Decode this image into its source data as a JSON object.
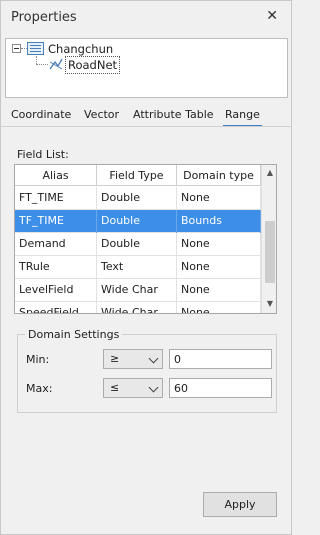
{
  "panel": {
    "title": "Properties",
    "close_glyph": "✕"
  },
  "tree": {
    "root": {
      "label": "Changchun",
      "icon": "datasource-icon",
      "expanded": true
    },
    "child": {
      "label": "RoadNet",
      "icon": "line-dataset-icon"
    }
  },
  "tabs": [
    {
      "label": "Coordinate",
      "active": false
    },
    {
      "label": "Vector",
      "active": false
    },
    {
      "label": "Attribute Table",
      "active": false
    },
    {
      "label": "Range",
      "active": true
    }
  ],
  "field_list": {
    "label": "Field List:",
    "columns": [
      "Alias",
      "Field Type",
      "Domain type"
    ],
    "rows": [
      {
        "alias": "FT_TIME",
        "type": "Double",
        "domain": "None",
        "selected": false
      },
      {
        "alias": "TF_TIME",
        "type": "Double",
        "domain": "Bounds",
        "selected": true
      },
      {
        "alias": "Demand",
        "type": "Double",
        "domain": "None",
        "selected": false
      },
      {
        "alias": "TRule",
        "type": "Text",
        "domain": "None",
        "selected": false
      },
      {
        "alias": "LevelField",
        "type": "Wide Char",
        "domain": "None",
        "selected": false
      },
      {
        "alias": "SpeedField",
        "type": "Wide Char",
        "domain": "None",
        "selected": false
      }
    ]
  },
  "domain_settings": {
    "title": "Domain Settings",
    "min": {
      "label": "Min:",
      "operator": "≥",
      "value": "0"
    },
    "max": {
      "label": "Max:",
      "operator": "≤",
      "value": "60"
    }
  },
  "buttons": {
    "apply": "Apply"
  },
  "colors": {
    "selection": "#3d8ee6",
    "tab_underline": "#3c7fc8",
    "panel_bg": "#f0f0f0"
  }
}
